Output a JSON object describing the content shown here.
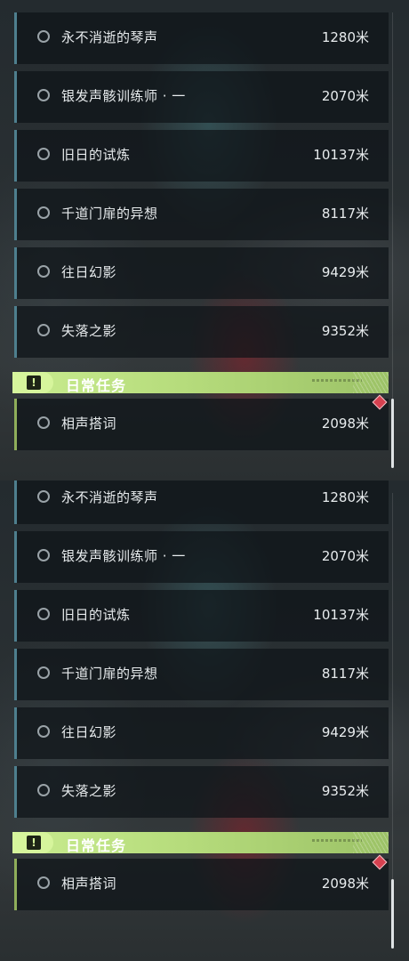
{
  "panels": [
    {
      "quests": [
        {
          "name": "永不消逝的琴声",
          "distance": "1280米"
        },
        {
          "name": "银发声骸训练师 · 一",
          "distance": "2070米"
        },
        {
          "name": "旧日的试炼",
          "distance": "10137米"
        },
        {
          "name": "千道门扉的异想",
          "distance": "8117米"
        },
        {
          "name": "往日幻影",
          "distance": "9429米"
        },
        {
          "name": "失落之影",
          "distance": "9352米"
        }
      ],
      "daily_header": {
        "title": "日常任务",
        "icon": "exclamation-box-icon"
      },
      "daily_quests": [
        {
          "name": "相声搭词",
          "distance": "2098米"
        }
      ]
    },
    {
      "quests": [
        {
          "name": "永不消逝的琴声",
          "distance": "1280米"
        },
        {
          "name": "银发声骸训练师 · 一",
          "distance": "2070米"
        },
        {
          "name": "旧日的试炼",
          "distance": "10137米"
        },
        {
          "name": "千道门扉的异想",
          "distance": "8117米"
        },
        {
          "name": "往日幻影",
          "distance": "9429米"
        },
        {
          "name": "失落之影",
          "distance": "9352米"
        }
      ],
      "daily_header": {
        "title": "日常任务",
        "icon": "exclamation-box-icon"
      },
      "daily_quests": [
        {
          "name": "相声搭词",
          "distance": "2098米"
        }
      ]
    }
  ],
  "colors": {
    "quest_accent": "#4e7f8e",
    "daily_accent": "#8fae5a",
    "daily_header": "#c9ec8f",
    "new_marker": "#d74150"
  }
}
